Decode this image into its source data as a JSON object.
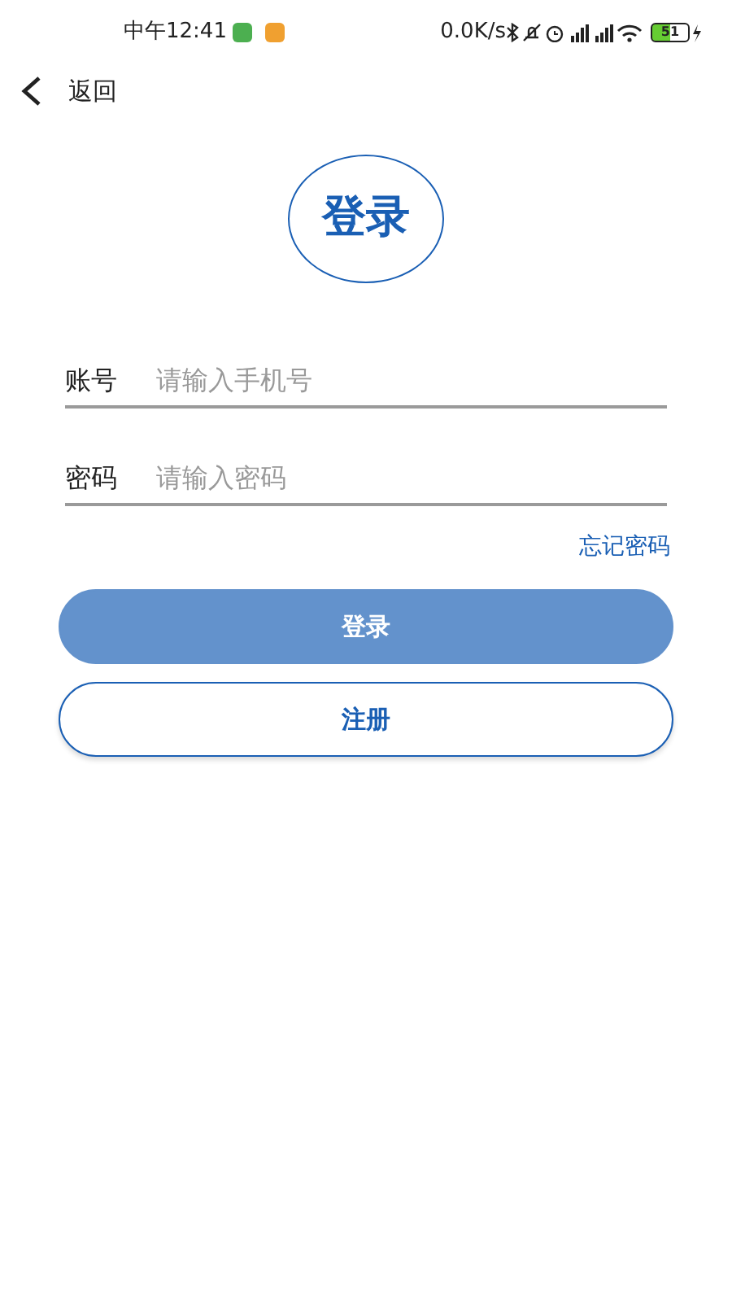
{
  "status_bar": {
    "time": "中午12:41",
    "speed": "0.0K/s",
    "battery": "51"
  },
  "header": {
    "back_label": "返回"
  },
  "logo": {
    "text": "登录"
  },
  "fields": [
    {
      "label": "账号",
      "placeholder": "请输入手机号"
    },
    {
      "label": "密码",
      "placeholder": "请输入密码"
    }
  ],
  "forgot_link": "忘记密码",
  "buttons": [
    {
      "label": "登录",
      "kind": "filled",
      "disabled": true
    },
    {
      "label": "注册",
      "kind": "outline",
      "disabled": false
    }
  ]
}
